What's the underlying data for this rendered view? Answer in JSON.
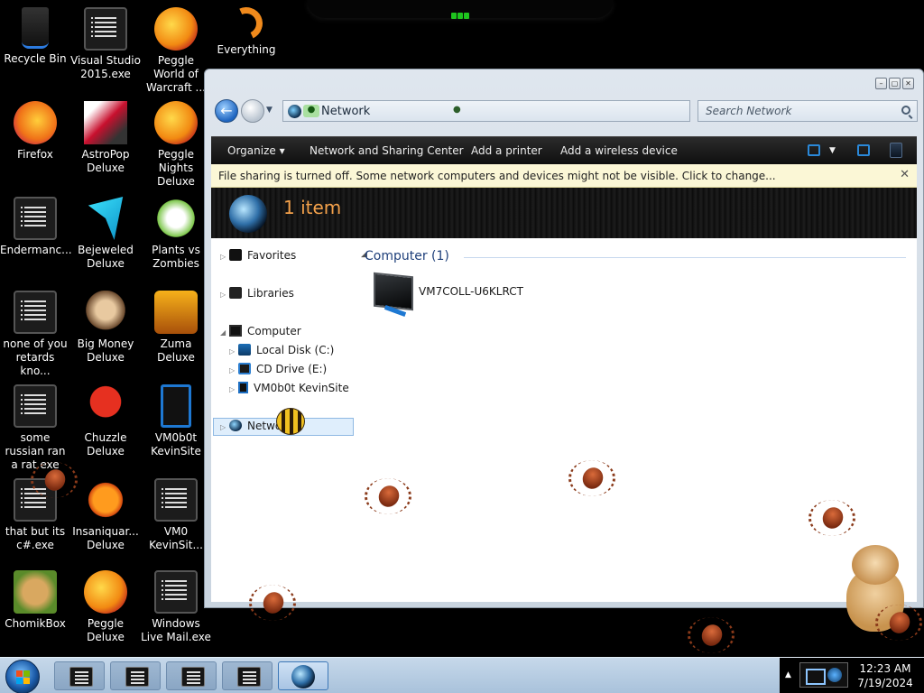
{
  "desktop": {
    "icons": [
      {
        "label": "Recycle Bin",
        "icon": "recycle-bin-icon"
      },
      {
        "label": "Visual Studio 2015.exe",
        "icon": "notepad-icon"
      },
      {
        "label": "Peggle World of Warcraft ...",
        "icon": "peggle-icon"
      },
      {
        "label": "Everything",
        "icon": "everything-icon"
      },
      {
        "label": "Firefox",
        "icon": "firefox-icon"
      },
      {
        "label": "AstroPop Deluxe",
        "icon": "astropop-icon"
      },
      {
        "label": "Peggle Nights Deluxe",
        "icon": "peggle-nights-icon"
      },
      {
        "label": "Endermanc...",
        "icon": "notepad-icon"
      },
      {
        "label": "Bejeweled Deluxe",
        "icon": "bejeweled-icon"
      },
      {
        "label": "Plants vs Zombies",
        "icon": "plants-vs-zombies-icon"
      },
      {
        "label": "none of you retards kno...",
        "icon": "notepad-icon"
      },
      {
        "label": "Big Money Deluxe",
        "icon": "big-money-icon"
      },
      {
        "label": "Zuma Deluxe",
        "icon": "zuma-icon"
      },
      {
        "label": "some russian ran a rat.exe",
        "icon": "notepad-icon"
      },
      {
        "label": "Chuzzle Deluxe",
        "icon": "chuzzle-icon"
      },
      {
        "label": "VM0b0t KevinSite",
        "icon": "tablet-icon"
      },
      {
        "label": "that but its c#.exe",
        "icon": "notepad-icon"
      },
      {
        "label": "Insaniquar... Deluxe",
        "icon": "insaniquarium-icon"
      },
      {
        "label": "VM0 KevinSit...",
        "icon": "notepad-icon"
      },
      {
        "label": "ChomikBox",
        "icon": "chomikbox-icon"
      },
      {
        "label": "Peggle Deluxe",
        "icon": "peggle-icon"
      },
      {
        "label": "Windows Live Mail.exe",
        "icon": "notepad-icon"
      }
    ]
  },
  "explorer": {
    "address_text": "Network",
    "search_placeholder": "Search Network",
    "commands": {
      "organize": "Organize",
      "network_sharing": "Network and Sharing Center",
      "add_printer": "Add a printer",
      "add_wireless": "Add a wireless device"
    },
    "infobar_text": "File sharing is turned off. Some network computers and devices might not be visible. Click to change...",
    "header_title": "1 item",
    "nav_tree": {
      "favorites": "Favorites",
      "libraries": "Libraries",
      "computer": "Computer",
      "local_disk": "Local Disk (C:)",
      "cd_drive": "CD Drive (E:)",
      "site": "VM0b0t KevinSite",
      "network": "Network"
    },
    "group_header": "Computer (1)",
    "items": [
      {
        "name": "VM7COLL-U6KLRCT"
      }
    ]
  },
  "taskbar": {
    "time": "12:23 AM",
    "date": "7/19/2024"
  }
}
